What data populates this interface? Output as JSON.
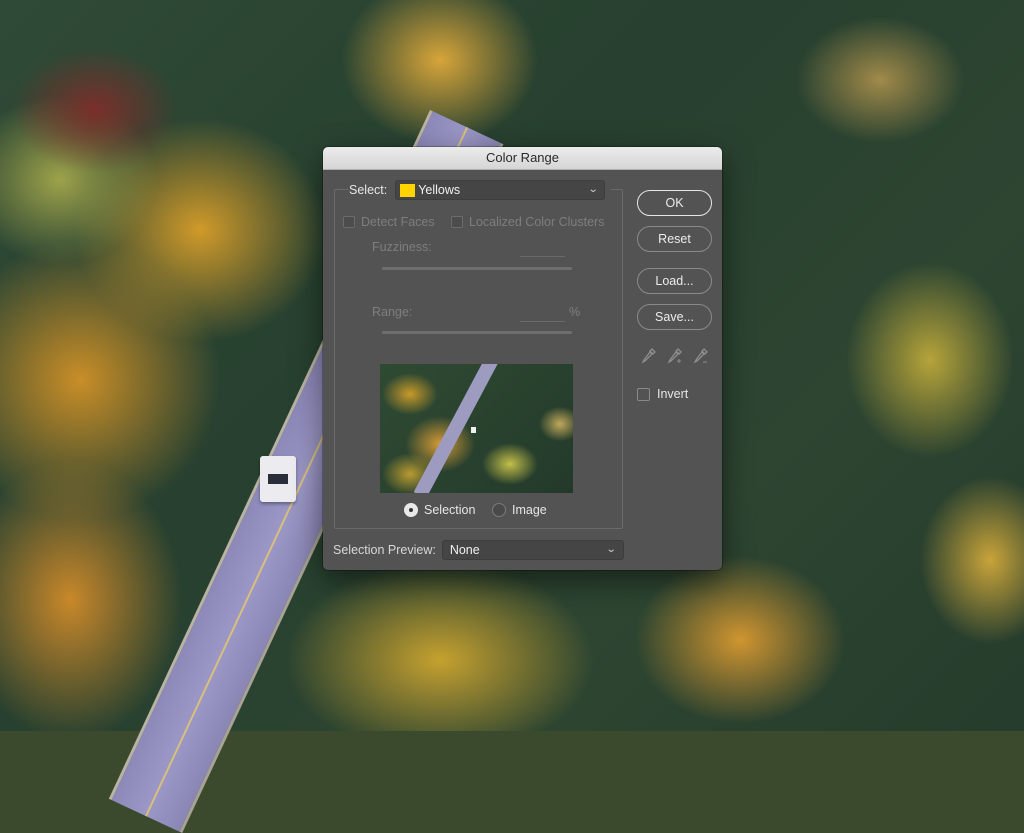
{
  "dialog": {
    "title": "Color Range",
    "select_label": "Select:",
    "select_value": "Yellows",
    "select_swatch_color": "#ffd400",
    "detect_faces_label": "Detect Faces",
    "localized_clusters_label": "Localized Color Clusters",
    "fuzziness_label": "Fuzziness:",
    "range_label": "Range:",
    "range_unit": "%",
    "preview_mode_options": [
      {
        "label": "Selection",
        "selected": true
      },
      {
        "label": "Image",
        "selected": false
      }
    ],
    "selection_preview_label": "Selection Preview:",
    "selection_preview_value": "None",
    "buttons": {
      "ok": "OK",
      "reset": "Reset",
      "load": "Load...",
      "save": "Save..."
    },
    "eyedropper_tools": [
      "eyedropper-icon",
      "eyedropper-plus-icon",
      "eyedropper-minus-icon"
    ],
    "invert_label": "Invert",
    "invert_checked": false
  }
}
